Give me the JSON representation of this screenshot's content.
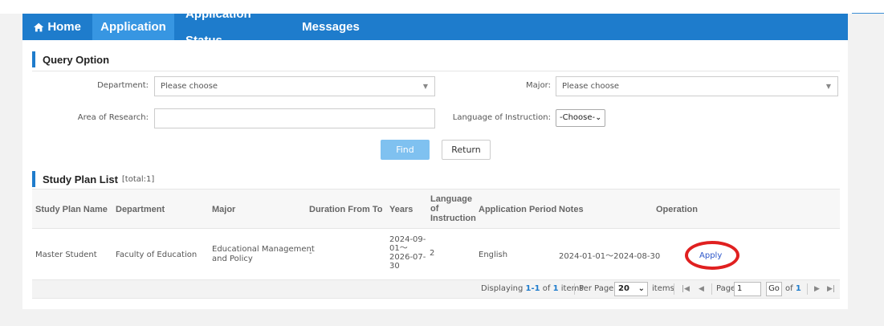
{
  "nav": {
    "home": "Home",
    "application": "Application",
    "application_status": "Application Status",
    "messages": "Messages"
  },
  "query": {
    "title": "Query Option",
    "department_label": "Department:",
    "department_value": "Please choose",
    "major_label": "Major:",
    "major_value": "Please choose",
    "research_label": "Area of Research:",
    "research_value": "",
    "language_label": "Language of Instruction:",
    "language_value": "-Choose-",
    "find_label": "Find",
    "return_label": "Return"
  },
  "list": {
    "title": "Study Plan List",
    "total": "[total:1]",
    "headers": {
      "name": "Study Plan Name",
      "department": "Department",
      "major": "Major",
      "duration": "Duration From To",
      "years": "Years",
      "language": [
        "Language",
        "of",
        "Instruction"
      ],
      "period": "Application Period",
      "notes": "Notes",
      "operation": "Operation"
    },
    "rows": [
      {
        "name": "Master Student",
        "department": "Faculty of Education",
        "major": [
          "Educational Management",
          "and Policy"
        ],
        "duration": "-",
        "years_lines": [
          "2024-09-",
          "01～",
          "2026-07-",
          "30"
        ],
        "language_col": "2",
        "language": "English",
        "period": "2024-01-01～2024-08-30",
        "notes": "",
        "operation": "Apply"
      }
    ]
  },
  "pager": {
    "displaying": "Displaying",
    "range": "1-1",
    "of": "of",
    "total": "1",
    "items": "items",
    "per_page": "Per Page",
    "per_page_value": "20",
    "items2": "items",
    "page_label": "Page",
    "page_value": "1",
    "go": "Go",
    "of2": "of",
    "pages": "1"
  },
  "colors": {
    "nav_bg": "#1e7ccc",
    "nav_active": "#3796e2",
    "find_bg": "#7fc1f0",
    "highlight_ring": "#e02020",
    "link": "#2b55c9"
  }
}
